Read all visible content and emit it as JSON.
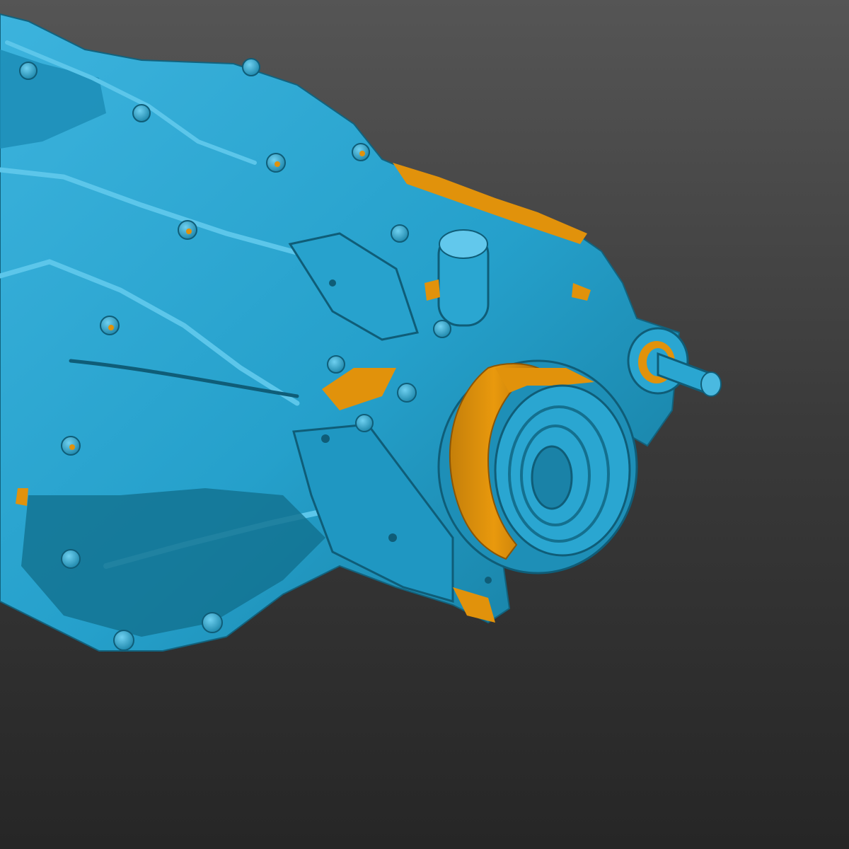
{
  "viewport": {
    "background_top": "#555555",
    "background_bottom": "#262626"
  },
  "model": {
    "icon": "gearbox-scan-mesh",
    "surface_color": "#29a4cf",
    "surface_highlight": "#5cc6ea",
    "surface_shadow": "#14708f",
    "backface_color": "#e1920b",
    "backface_shadow": "#a8680a"
  }
}
